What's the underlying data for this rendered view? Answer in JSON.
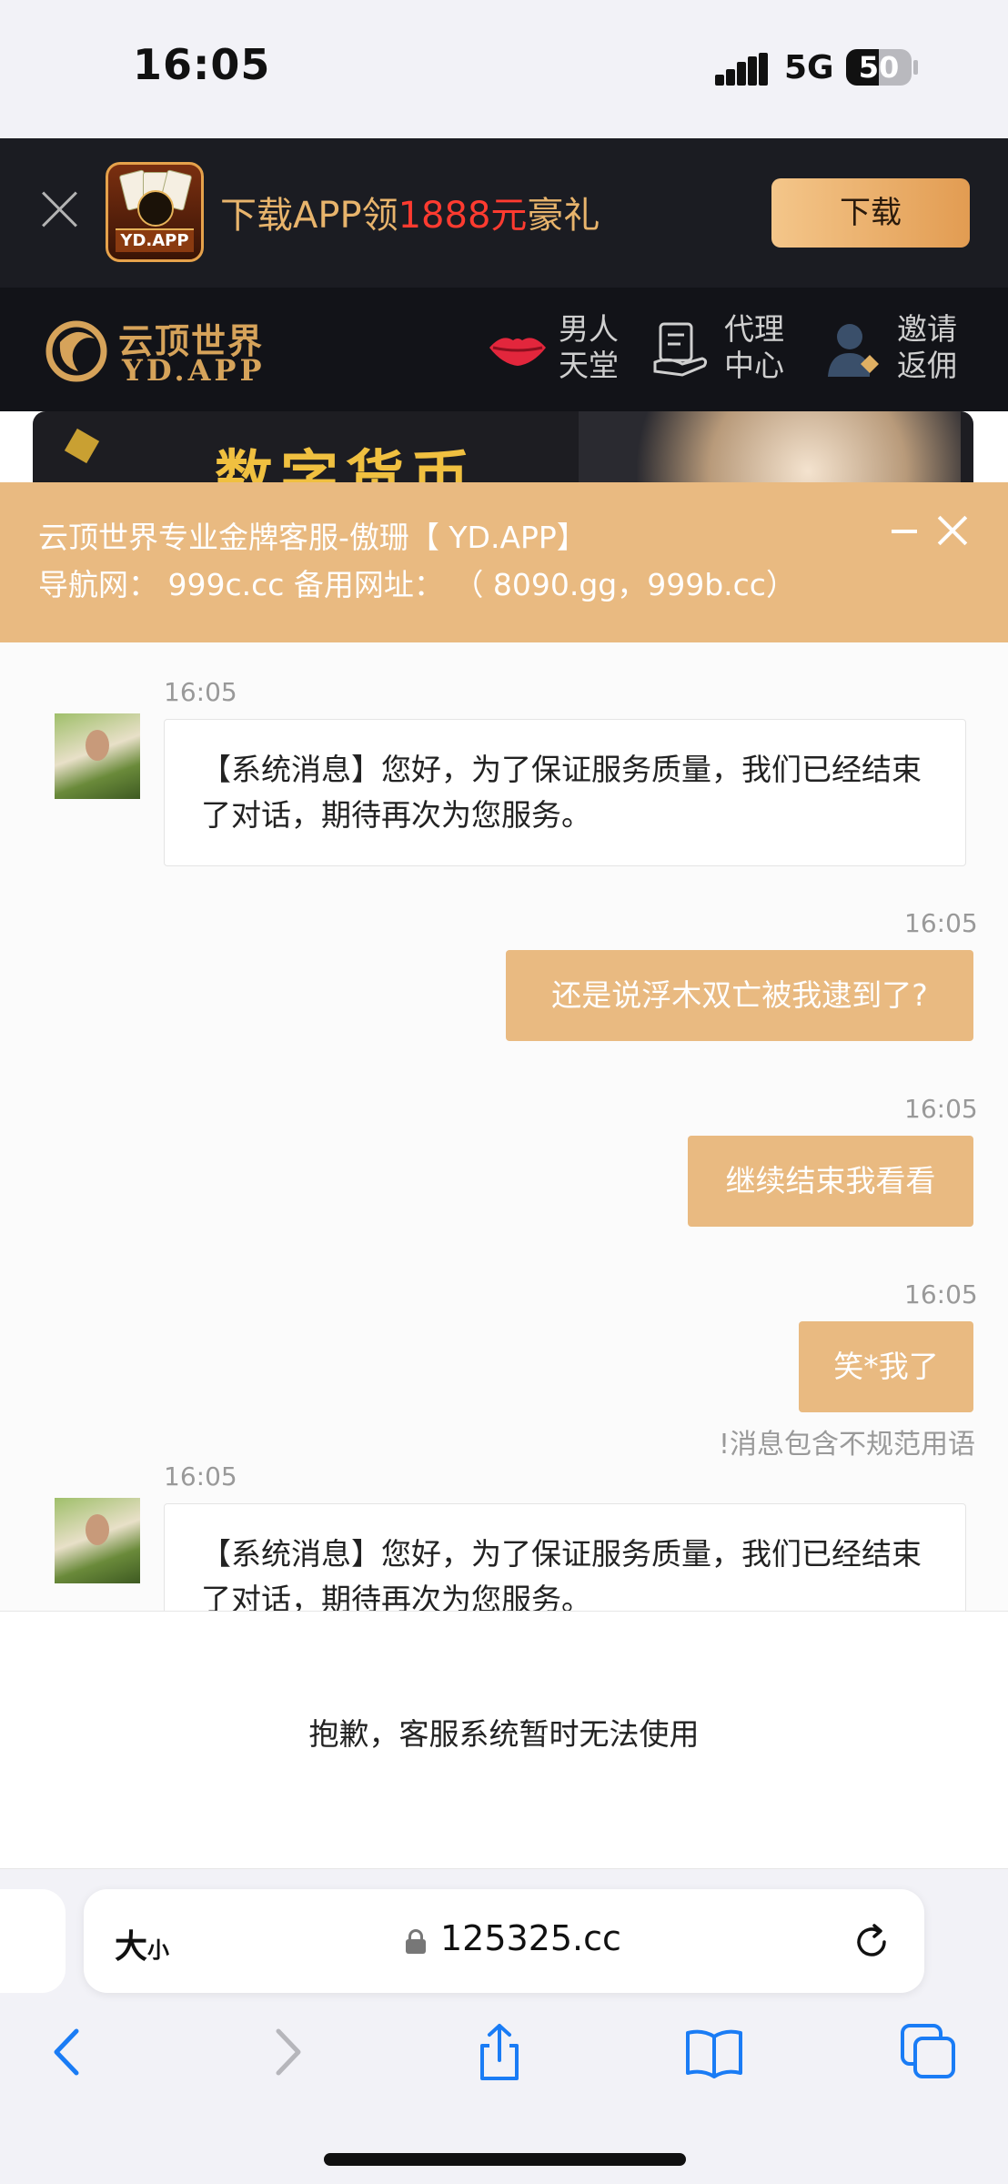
{
  "status_bar": {
    "time": "16:05",
    "network": "5G",
    "battery": "50",
    "battery_level_pct": 50
  },
  "download_banner": {
    "title_prefix": "下载APP领",
    "title_highlight": "1888元",
    "title_suffix": "豪礼",
    "app_icon_label": "YD.APP",
    "download_button": "下载"
  },
  "site_header": {
    "logo_cn": "云顶世界",
    "logo_en": "YD.APP",
    "links": [
      {
        "line1": "男人",
        "line2": "天堂",
        "icon": "lips-icon"
      },
      {
        "line1": "代理",
        "line2": "中心",
        "icon": "agent-icon"
      },
      {
        "line1": "邀请",
        "line2": "返佣",
        "icon": "invite-icon"
      }
    ],
    "hero_text": "数字货币"
  },
  "chat": {
    "title": "云顶世界专业金牌客服-傲珊【 YD.APP】",
    "subtitle": "导航网： 999c.cc 备用网址： （ 8090.gg，999b.cc）",
    "messages": [
      {
        "from": "agent",
        "time": "16:05",
        "text": "【系统消息】您好，为了保证服务质量，我们已经结束了对话，期待再次为您服务。"
      },
      {
        "from": "user",
        "time": "16:05",
        "text": "还是说浮木双亡被我逮到了?"
      },
      {
        "from": "user",
        "time": "16:05",
        "text": "继续结束我看看"
      },
      {
        "from": "user",
        "time": "16:05",
        "text": "笑*我了",
        "warning": "!消息包含不规范用语"
      },
      {
        "from": "agent",
        "time": "16:05",
        "text": "【系统消息】您好，为了保证服务质量，我们已经结束了对话，期待再次为您服务。"
      }
    ],
    "unavailable": "抱歉，客服系统暂时无法使用"
  },
  "browser": {
    "text_size_label": "大",
    "text_size_small": "小",
    "url": "125325.cc"
  },
  "colors": {
    "accent": "#e9ba81",
    "dark_header": "#121318",
    "price_red": "#ff3b30"
  }
}
